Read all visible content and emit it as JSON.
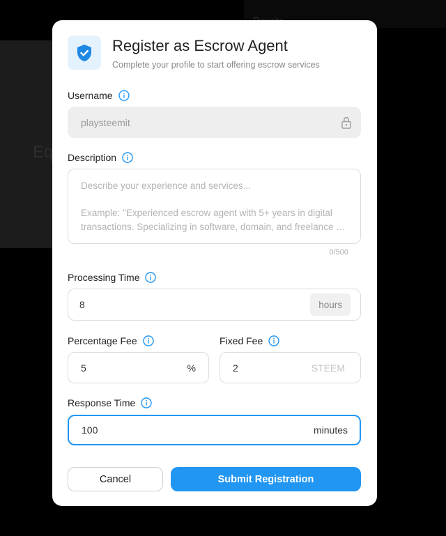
{
  "background": {
    "top_text": "Rewrite",
    "heading": "Eq"
  },
  "modal": {
    "title": "Register as Escrow Agent",
    "subtitle": "Complete your profile to start offering escrow services",
    "header_icon": "shield-check-icon",
    "accent_color": "#2196f3"
  },
  "form": {
    "username": {
      "label": "Username",
      "value": "playsteemit"
    },
    "description": {
      "label": "Description",
      "placeholder_line1": "Describe your experience and services...",
      "placeholder_line2": "Example: \"Experienced escrow agent with 5+ years in digital",
      "placeholder_line3": "transactions. Specializing in software, domain, and freelance services\"",
      "counter": "0/500"
    },
    "processing_time": {
      "label": "Processing Time",
      "value": "8",
      "unit": "hours"
    },
    "percentage_fee": {
      "label": "Percentage Fee",
      "value": "5",
      "unit": "%"
    },
    "fixed_fee": {
      "label": "Fixed Fee",
      "value": "2",
      "unit": "STEEM"
    },
    "response_time": {
      "label": "Response Time",
      "value": "100",
      "unit": "minutes"
    }
  },
  "actions": {
    "cancel_label": "Cancel",
    "submit_label": "Submit Registration"
  }
}
